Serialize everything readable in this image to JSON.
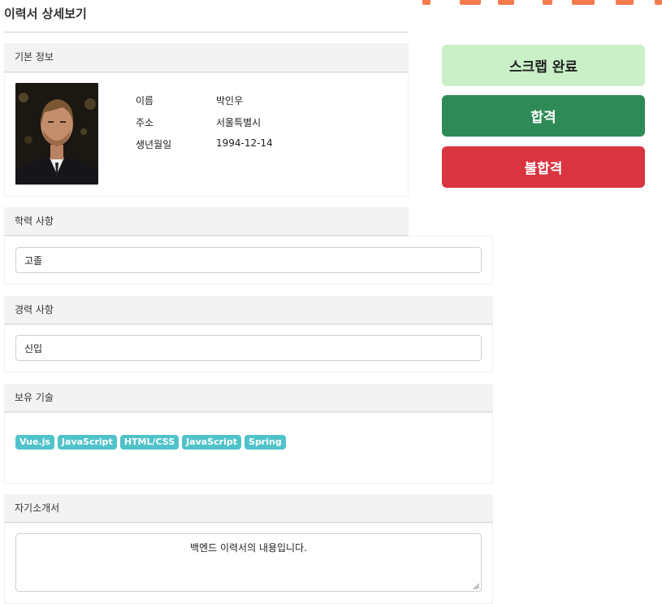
{
  "page": {
    "title": "이력서 상세보기"
  },
  "basic_info": {
    "header": "기본 정보",
    "fields": [
      {
        "label": "이름",
        "value": "박인우"
      },
      {
        "label": "주소",
        "value": "서울특별시"
      },
      {
        "label": "생년월일",
        "value": "1994-12-14"
      }
    ]
  },
  "education": {
    "header": "학력 사항",
    "value": "고졸"
  },
  "career": {
    "header": "경력 사항",
    "value": "신입"
  },
  "skills": {
    "header": "보유 기술",
    "items": [
      "Vue.js",
      "JavaScript",
      "HTML/CSS",
      "JavaScript",
      "Spring"
    ]
  },
  "introduction": {
    "header": "자기소개서",
    "value": "백엔드 이력서의 내용입니다."
  },
  "actions": {
    "scrap": "스크랩 완료",
    "pass": "합격",
    "fail": "불합격"
  },
  "colors": {
    "scrap_bg": "#c9f0c7",
    "pass_bg": "#2e8b57",
    "fail_bg": "#d9343f",
    "skill_badge": "#4fc3c9",
    "accent_orange": "#f47c4e"
  }
}
